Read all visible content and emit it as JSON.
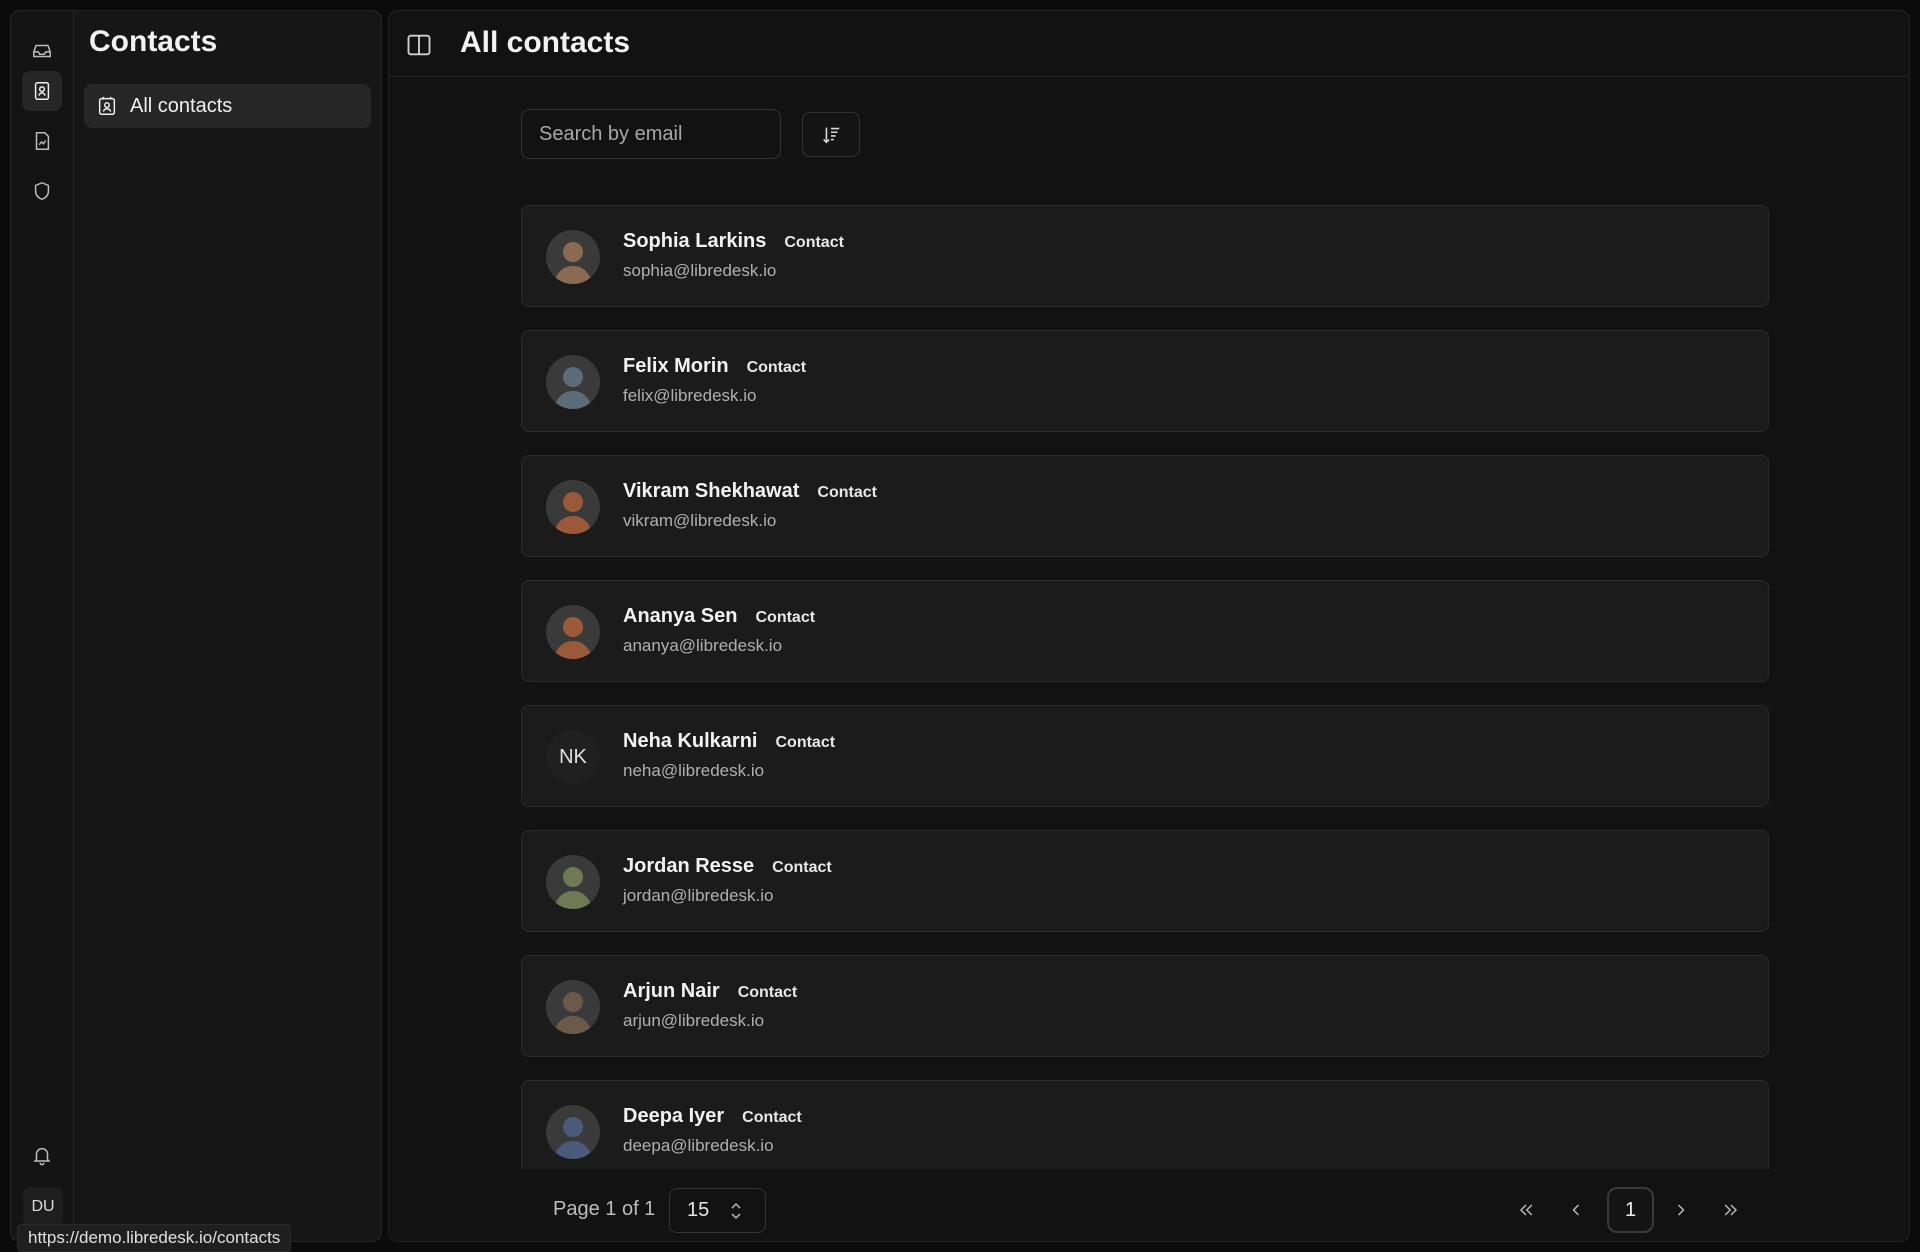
{
  "sidebar": {
    "title": "Contacts",
    "items": [
      {
        "label": "All contacts",
        "icon": "contact-card-icon"
      }
    ]
  },
  "rail": {
    "icons": [
      "inbox-icon",
      "contacts-icon",
      "reports-icon",
      "shield-icon",
      "bell-icon"
    ],
    "user_initials": "DU"
  },
  "main": {
    "title": "All contacts",
    "search": {
      "placeholder": "Search by email",
      "value": ""
    },
    "contacts": [
      {
        "name": "Sophia Larkins",
        "tag": "Contact",
        "email": "sophia@libredesk.io",
        "avatar_color": "#8a6a52"
      },
      {
        "name": "Felix Morin",
        "tag": "Contact",
        "email": "felix@libredesk.io",
        "avatar_color": "#5d6b78"
      },
      {
        "name": "Vikram Shekhawat",
        "tag": "Contact",
        "email": "vikram@libredesk.io",
        "avatar_color": "#9a5a3a"
      },
      {
        "name": "Ananya Sen",
        "tag": "Contact",
        "email": "ananya@libredesk.io",
        "avatar_color": "#9a5a3a"
      },
      {
        "name": "Neha Kulkarni",
        "tag": "Contact",
        "email": "neha@libredesk.io",
        "initials": "NK"
      },
      {
        "name": "Jordan Resse",
        "tag": "Contact",
        "email": "jordan@libredesk.io",
        "avatar_color": "#6f7a55"
      },
      {
        "name": "Arjun Nair",
        "tag": "Contact",
        "email": "arjun@libredesk.io",
        "avatar_color": "#6b5a4a"
      },
      {
        "name": "Deepa Iyer",
        "tag": "Contact",
        "email": "deepa@libredesk.io",
        "avatar_color": "#4a5a7a"
      }
    ]
  },
  "pagination": {
    "page_info": "Page 1 of 1",
    "page_size": "15",
    "current_page": "1"
  },
  "status_url": "https://demo.libredesk.io/contacts"
}
